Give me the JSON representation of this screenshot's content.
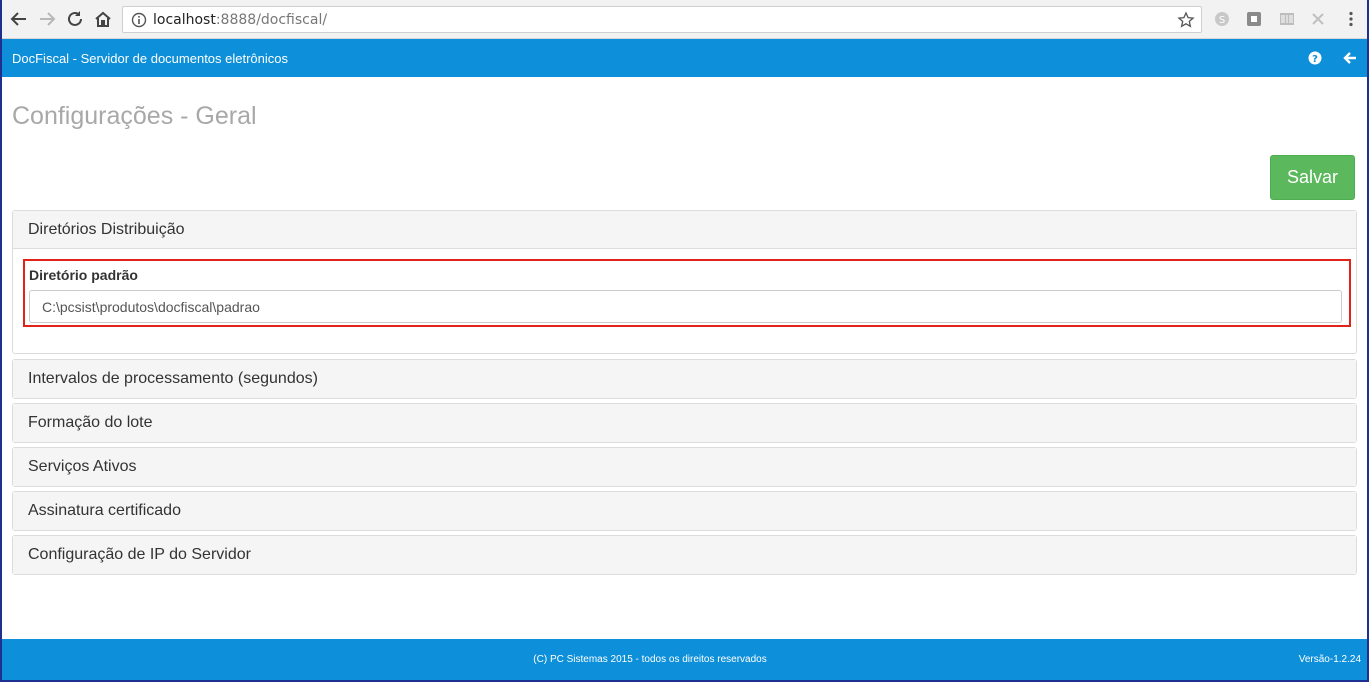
{
  "browser": {
    "url_host": "localhost",
    "url_path": ":8888/docfiscal/"
  },
  "app": {
    "title": "DocFiscal - Servidor de documentos eletrônicos"
  },
  "page": {
    "title": "Configurações - Geral",
    "save_label": "Salvar"
  },
  "panels": [
    {
      "title": "Diretórios Distribuição",
      "field_label": "Diretório padrão",
      "field_value": "C:\\pcsist\\produtos\\docfiscal\\padrao"
    },
    {
      "title": "Intervalos de processamento (segundos)"
    },
    {
      "title": "Formação do lote"
    },
    {
      "title": "Serviços Ativos"
    },
    {
      "title": "Assinatura certificado"
    },
    {
      "title": "Configuração de IP do Servidor"
    }
  ],
  "footer": {
    "copyright": "(C) PC Sistemas 2015 - todos os direitos reservados",
    "version": "Versão-1.2.24"
  },
  "colors": {
    "header_bg": "#0d8fd9",
    "save_button": "#5cb85c",
    "highlight": "#e2231a"
  },
  "icons": [
    "back-icon",
    "forward-icon",
    "reload-icon",
    "home-icon",
    "info-icon",
    "star-icon",
    "help-icon",
    "arrow-left-icon"
  ]
}
